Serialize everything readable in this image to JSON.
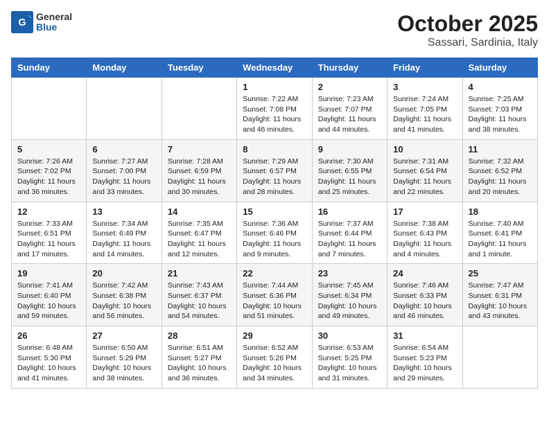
{
  "header": {
    "logo_general": "General",
    "logo_blue": "Blue",
    "title": "October 2025",
    "subtitle": "Sassari, Sardinia, Italy"
  },
  "days_of_week": [
    "Sunday",
    "Monday",
    "Tuesday",
    "Wednesday",
    "Thursday",
    "Friday",
    "Saturday"
  ],
  "weeks": [
    [
      {
        "day": "",
        "info": ""
      },
      {
        "day": "",
        "info": ""
      },
      {
        "day": "",
        "info": ""
      },
      {
        "day": "1",
        "info": "Sunrise: 7:22 AM\nSunset: 7:08 PM\nDaylight: 11 hours and 46 minutes."
      },
      {
        "day": "2",
        "info": "Sunrise: 7:23 AM\nSunset: 7:07 PM\nDaylight: 11 hours and 44 minutes."
      },
      {
        "day": "3",
        "info": "Sunrise: 7:24 AM\nSunset: 7:05 PM\nDaylight: 11 hours and 41 minutes."
      },
      {
        "day": "4",
        "info": "Sunrise: 7:25 AM\nSunset: 7:03 PM\nDaylight: 11 hours and 38 minutes."
      }
    ],
    [
      {
        "day": "5",
        "info": "Sunrise: 7:26 AM\nSunset: 7:02 PM\nDaylight: 11 hours and 36 minutes."
      },
      {
        "day": "6",
        "info": "Sunrise: 7:27 AM\nSunset: 7:00 PM\nDaylight: 11 hours and 33 minutes."
      },
      {
        "day": "7",
        "info": "Sunrise: 7:28 AM\nSunset: 6:59 PM\nDaylight: 11 hours and 30 minutes."
      },
      {
        "day": "8",
        "info": "Sunrise: 7:29 AM\nSunset: 6:57 PM\nDaylight: 11 hours and 28 minutes."
      },
      {
        "day": "9",
        "info": "Sunrise: 7:30 AM\nSunset: 6:55 PM\nDaylight: 11 hours and 25 minutes."
      },
      {
        "day": "10",
        "info": "Sunrise: 7:31 AM\nSunset: 6:54 PM\nDaylight: 11 hours and 22 minutes."
      },
      {
        "day": "11",
        "info": "Sunrise: 7:32 AM\nSunset: 6:52 PM\nDaylight: 11 hours and 20 minutes."
      }
    ],
    [
      {
        "day": "12",
        "info": "Sunrise: 7:33 AM\nSunset: 6:51 PM\nDaylight: 11 hours and 17 minutes."
      },
      {
        "day": "13",
        "info": "Sunrise: 7:34 AM\nSunset: 6:49 PM\nDaylight: 11 hours and 14 minutes."
      },
      {
        "day": "14",
        "info": "Sunrise: 7:35 AM\nSunset: 6:47 PM\nDaylight: 11 hours and 12 minutes."
      },
      {
        "day": "15",
        "info": "Sunrise: 7:36 AM\nSunset: 6:46 PM\nDaylight: 11 hours and 9 minutes."
      },
      {
        "day": "16",
        "info": "Sunrise: 7:37 AM\nSunset: 6:44 PM\nDaylight: 11 hours and 7 minutes."
      },
      {
        "day": "17",
        "info": "Sunrise: 7:38 AM\nSunset: 6:43 PM\nDaylight: 11 hours and 4 minutes."
      },
      {
        "day": "18",
        "info": "Sunrise: 7:40 AM\nSunset: 6:41 PM\nDaylight: 11 hours and 1 minute."
      }
    ],
    [
      {
        "day": "19",
        "info": "Sunrise: 7:41 AM\nSunset: 6:40 PM\nDaylight: 10 hours and 59 minutes."
      },
      {
        "day": "20",
        "info": "Sunrise: 7:42 AM\nSunset: 6:38 PM\nDaylight: 10 hours and 56 minutes."
      },
      {
        "day": "21",
        "info": "Sunrise: 7:43 AM\nSunset: 6:37 PM\nDaylight: 10 hours and 54 minutes."
      },
      {
        "day": "22",
        "info": "Sunrise: 7:44 AM\nSunset: 6:36 PM\nDaylight: 10 hours and 51 minutes."
      },
      {
        "day": "23",
        "info": "Sunrise: 7:45 AM\nSunset: 6:34 PM\nDaylight: 10 hours and 49 minutes."
      },
      {
        "day": "24",
        "info": "Sunrise: 7:46 AM\nSunset: 6:33 PM\nDaylight: 10 hours and 46 minutes."
      },
      {
        "day": "25",
        "info": "Sunrise: 7:47 AM\nSunset: 6:31 PM\nDaylight: 10 hours and 43 minutes."
      }
    ],
    [
      {
        "day": "26",
        "info": "Sunrise: 6:48 AM\nSunset: 5:30 PM\nDaylight: 10 hours and 41 minutes."
      },
      {
        "day": "27",
        "info": "Sunrise: 6:50 AM\nSunset: 5:29 PM\nDaylight: 10 hours and 38 minutes."
      },
      {
        "day": "28",
        "info": "Sunrise: 6:51 AM\nSunset: 5:27 PM\nDaylight: 10 hours and 36 minutes."
      },
      {
        "day": "29",
        "info": "Sunrise: 6:52 AM\nSunset: 5:26 PM\nDaylight: 10 hours and 34 minutes."
      },
      {
        "day": "30",
        "info": "Sunrise: 6:53 AM\nSunset: 5:25 PM\nDaylight: 10 hours and 31 minutes."
      },
      {
        "day": "31",
        "info": "Sunrise: 6:54 AM\nSunset: 5:23 PM\nDaylight: 10 hours and 29 minutes."
      },
      {
        "day": "",
        "info": ""
      }
    ]
  ]
}
